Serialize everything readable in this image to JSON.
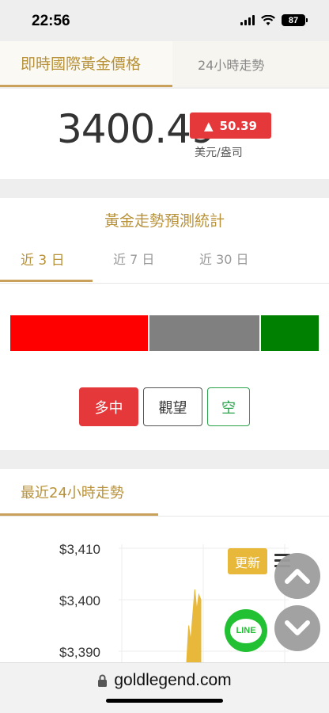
{
  "status_bar": {
    "time": "22:56",
    "battery": "87"
  },
  "price_tabs": {
    "active": "即時國際黃金價格",
    "other": "24小時走勢"
  },
  "price": {
    "value": "3400.49",
    "change_arrow": "▲",
    "change": "50.39",
    "unit": "美元/盎司",
    "change_color": "#e5383b"
  },
  "forecast": {
    "title": "黃金走勢預測統計",
    "periods": [
      "近 3 日",
      "近 7 日",
      "近 30 日"
    ],
    "active_period": "近 3 日",
    "distribution": [
      {
        "label": "多中",
        "share": 0.45,
        "color": "#ff0000"
      },
      {
        "label": "觀望",
        "share": 0.36,
        "color": "#808080"
      },
      {
        "label": "空",
        "share": 0.19,
        "color": "#008000"
      }
    ],
    "buttons": {
      "bull": "多中",
      "neutral": "觀望",
      "bear": "空"
    }
  },
  "trend": {
    "title": "最近24小時走勢",
    "refresh": "更新",
    "chart_data": {
      "type": "area",
      "yticks": [
        "$3,410",
        "$3,400",
        "$3,390"
      ],
      "ylim": [
        3390,
        3410
      ],
      "series": [
        {
          "values": [
            3388,
            3395,
            3392,
            3397,
            3402,
            3398,
            3401,
            3400
          ]
        }
      ],
      "grid": true,
      "color": "#e8b83a"
    }
  },
  "floating": {
    "line_label": "LINE"
  },
  "browser": {
    "url": "goldlegend.com"
  }
}
